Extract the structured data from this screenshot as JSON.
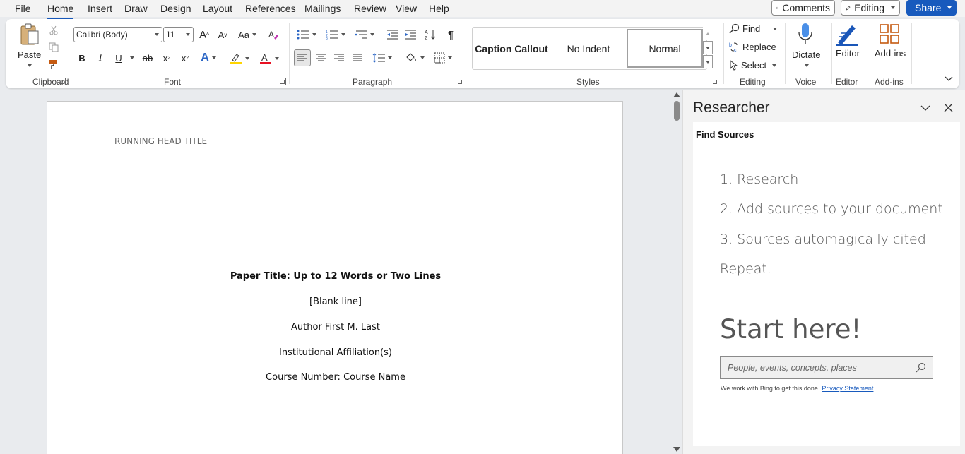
{
  "menu": {
    "tabs": [
      "File",
      "Home",
      "Insert",
      "Draw",
      "Design",
      "Layout",
      "References",
      "Mailings",
      "Review",
      "View",
      "Help"
    ],
    "active_tab": "Home",
    "comments_label": "Comments",
    "editing_label": "Editing",
    "share_label": "Share"
  },
  "ribbon": {
    "clipboard": {
      "label": "Clipboard",
      "paste_label": "Paste"
    },
    "font": {
      "label": "Font",
      "font_name": "Calibri (Body)",
      "font_size": "11",
      "bold": "B",
      "italic": "I",
      "underline": "U",
      "strike": "ab",
      "subscript": "x",
      "superscript": "x",
      "grow": "A",
      "shrink": "A",
      "change_case": "Aa",
      "text_effects": "A",
      "font_color": "A",
      "highlight_color": "#ffff00",
      "font_color_value": "#e81123"
    },
    "paragraph": {
      "label": "Paragraph",
      "pilcrow": "¶"
    },
    "styles": {
      "label": "Styles",
      "items": [
        "Caption Callout",
        "No Indent",
        "Normal"
      ],
      "selected": "Normal"
    },
    "editing": {
      "label": "Editing",
      "find": "Find",
      "replace": "Replace",
      "select": "Select"
    },
    "voice": {
      "label": "Voice",
      "dictate": "Dictate"
    },
    "editor": {
      "label": "Editor",
      "editor_btn": "Editor"
    },
    "addins": {
      "label": "Add-ins",
      "addins_btn": "Add-ins"
    }
  },
  "document": {
    "running_head": "RUNNING HEAD TITLE",
    "title": "Paper Title: Up to 12 Words or Two Lines",
    "blank_line": "[Blank line]",
    "author": "Author First M. Last",
    "affiliation": "Institutional Affiliation(s)",
    "course": "Course Number: Course Name"
  },
  "researcher": {
    "title": "Researcher",
    "find_sources": "Find Sources",
    "steps": [
      "1. Research",
      "2. Add sources to your document",
      "3. Sources automagically cited",
      "Repeat."
    ],
    "start_here": "Start here!",
    "search_placeholder": "People, events, concepts, places",
    "bing_note": "We work with Bing to get this done.",
    "privacy_link": "Privacy Statement"
  },
  "colors": {
    "accent": "#185abd",
    "active_tab_underline": "#185abd",
    "icon_blue": "#2b66c5",
    "icon_orange": "#c55a11"
  }
}
